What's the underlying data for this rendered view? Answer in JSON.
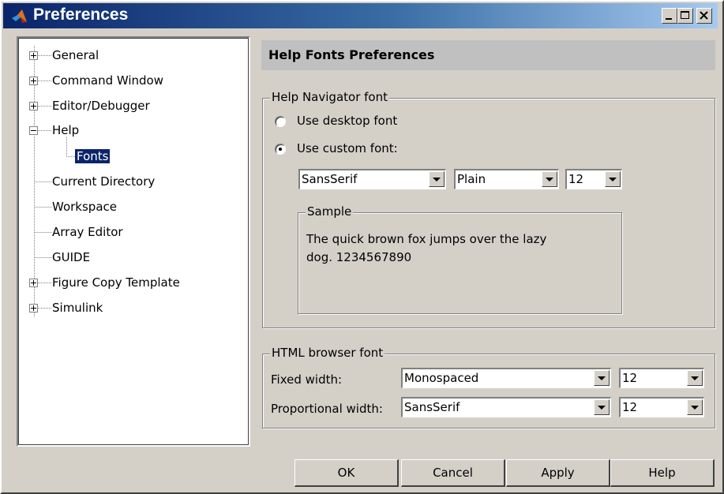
{
  "window": {
    "title": "Preferences",
    "icons": [
      "matlab-logo-icon",
      "minimize-icon",
      "maximize-icon",
      "close-icon"
    ]
  },
  "tree": {
    "items": [
      {
        "label": "General",
        "expander": "+"
      },
      {
        "label": "Command Window",
        "expander": "+"
      },
      {
        "label": "Editor/Debugger",
        "expander": "+"
      },
      {
        "label": "Help",
        "expander": "-"
      },
      {
        "label": "Fonts",
        "selected": true
      },
      {
        "label": "Current Directory"
      },
      {
        "label": "Workspace"
      },
      {
        "label": "Array Editor"
      },
      {
        "label": "GUIDE"
      },
      {
        "label": "Figure Copy Template",
        "expander": "+"
      },
      {
        "label": "Simulink",
        "expander": "+"
      }
    ]
  },
  "panel": {
    "header": "Help Fonts Preferences",
    "navigator": {
      "group_label": "Help Navigator font",
      "radio_desktop": "Use desktop font",
      "radio_custom": "Use custom font:",
      "selected_radio": "custom",
      "font_name": "SansSerif",
      "font_style": "Plain",
      "font_size": "12",
      "sample_label": "Sample",
      "sample_line1": "The quick brown fox jumps over the lazy",
      "sample_line2": "dog. 1234567890"
    },
    "html": {
      "group_label": "HTML browser font",
      "fixed_label": "Fixed width:",
      "fixed_font": "Monospaced",
      "fixed_size": "12",
      "prop_label": "Proportional width:",
      "prop_font": "SansSerif",
      "prop_size": "12"
    }
  },
  "buttons": {
    "ok": "OK",
    "cancel": "Cancel",
    "apply": "Apply",
    "help": "Help"
  },
  "colors": {
    "title_gradient_start": "#0a246a",
    "title_gradient_end": "#a6caf0",
    "selection": "#0a246a",
    "face": "#d4d0c8"
  }
}
